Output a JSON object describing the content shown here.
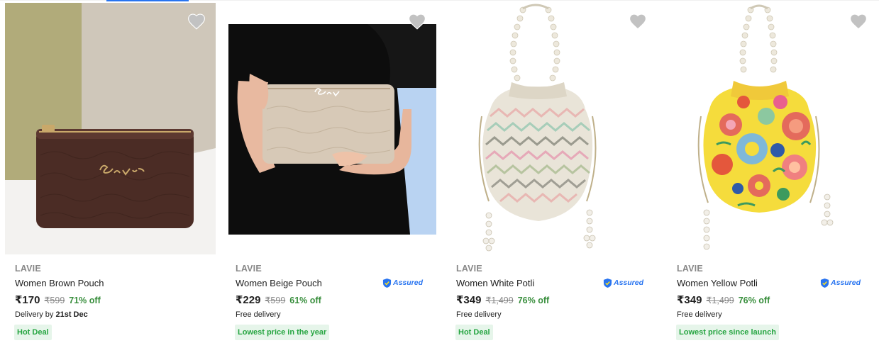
{
  "products": [
    {
      "brand": "LAVIE",
      "title": "Women Brown Pouch",
      "assured": false,
      "price": "₹170",
      "mrp": "₹599",
      "discount": "71% off",
      "delivery_prefix": "Delivery by ",
      "delivery_bold": "21st Dec",
      "badge": "Hot Deal",
      "image": "brown-pouch"
    },
    {
      "brand": "LAVIE",
      "title": "Women Beige Pouch",
      "assured": true,
      "assured_label": "Assured",
      "price": "₹229",
      "mrp": "₹599",
      "discount": "61% off",
      "delivery_prefix": "Free delivery",
      "delivery_bold": "",
      "badge": "Lowest price in the year",
      "image": "beige-pouch"
    },
    {
      "brand": "LAVIE",
      "title": "Women White Potli",
      "assured": true,
      "assured_label": "Assured",
      "price": "₹349",
      "mrp": "₹1,499",
      "discount": "76% off",
      "delivery_prefix": "Free delivery",
      "delivery_bold": "",
      "badge": "Hot Deal",
      "image": "white-potli"
    },
    {
      "brand": "LAVIE",
      "title": "Women Yellow Potli",
      "assured": true,
      "assured_label": "Assured",
      "price": "₹349",
      "mrp": "₹1,499",
      "discount": "76% off",
      "delivery_prefix": "Free delivery",
      "delivery_bold": "",
      "badge": "Lowest price since launch",
      "image": "yellow-potli"
    }
  ],
  "colors": {
    "accent": "#2874f0",
    "discount_green": "#388e3c",
    "badge_bg": "#e6f5ea",
    "badge_text": "#26a541",
    "heart": "#c2c2c2"
  },
  "icons": {
    "wishlist": "heart-icon",
    "assured": "assured-shield-icon"
  }
}
